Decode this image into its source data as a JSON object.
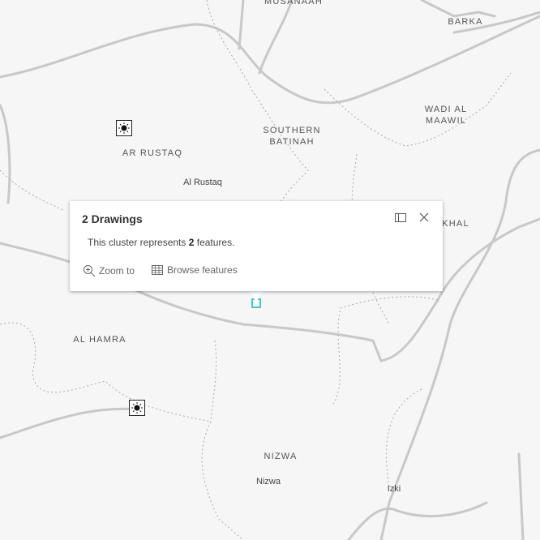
{
  "map": {
    "region_labels": [
      "MUSANAAH",
      "BARKA",
      "WADI AL\nMAAWIL",
      "SOUTHERN\nBATINAH",
      "AR RUSTAQ",
      "KHAL",
      "AL HAMRA",
      "NIZWA"
    ],
    "city_labels": [
      "Al Rustaq",
      "Nizwa",
      "Izki"
    ],
    "markers": [
      {
        "icon": "sun-icon"
      },
      {
        "icon": "sun-icon"
      }
    ],
    "selection_color": "#3dc8d4"
  },
  "popup": {
    "title": "2 Drawings",
    "body_prefix": "This cluster represents ",
    "body_count": "2",
    "body_suffix": " features.",
    "actions": [
      {
        "label": "Zoom to",
        "icon": "zoom-in-icon"
      },
      {
        "label": "Browse features",
        "icon": "table-icon"
      }
    ],
    "dock_icon": "dock-icon",
    "close_icon": "close-icon"
  }
}
